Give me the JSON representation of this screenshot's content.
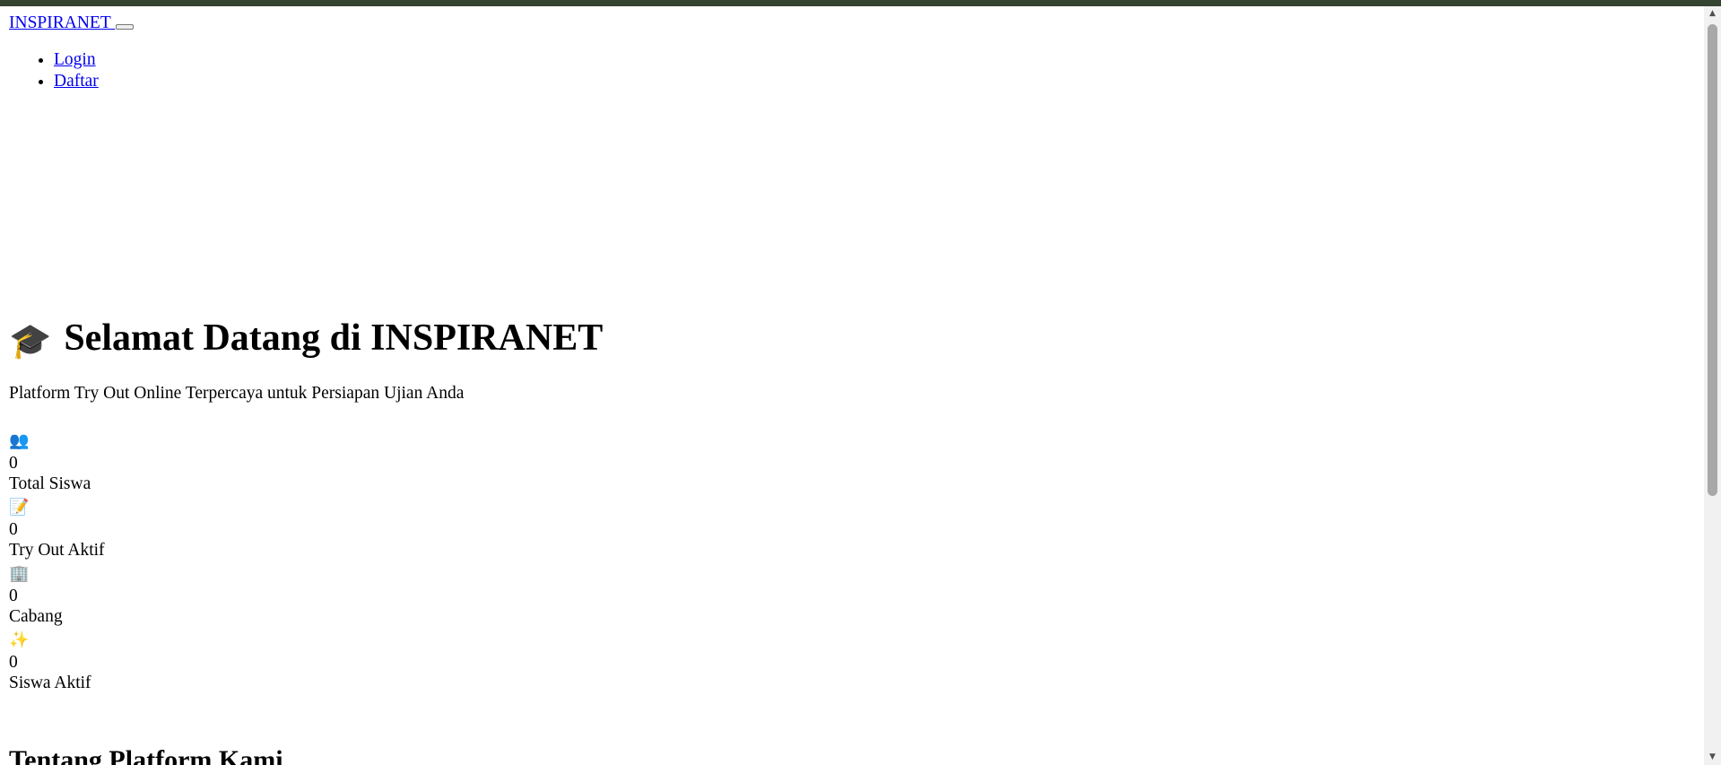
{
  "navbar": {
    "brand": "INSPIRANET",
    "menu": [
      {
        "label": "Login"
      },
      {
        "label": "Daftar"
      }
    ]
  },
  "hero": {
    "icon": "🎓",
    "title": "Selamat Datang di INSPIRANET",
    "tagline": "Platform Try Out Online Terpercaya untuk Persiapan Ujian Anda"
  },
  "stats": [
    {
      "icon": "👥",
      "icon_name": "users-icon",
      "value": "0",
      "label": "Total Siswa"
    },
    {
      "icon": "📝",
      "icon_name": "memo-icon",
      "value": "0",
      "label": "Try Out Aktif"
    },
    {
      "icon": "🏢",
      "icon_name": "building-icon",
      "value": "0",
      "label": "Cabang"
    },
    {
      "icon": "✨",
      "icon_name": "sparkles-icon",
      "value": "0",
      "label": "Siswa Aktif"
    }
  ],
  "about": {
    "title": "Tentang Platform Kami"
  },
  "colors": {
    "topbar": "#354331",
    "link": "#0000ee"
  }
}
